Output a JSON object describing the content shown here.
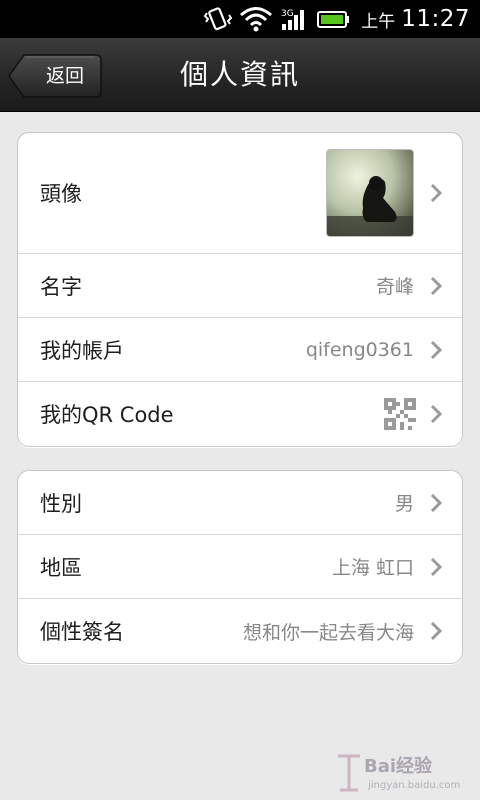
{
  "status_bar": {
    "ampm": "上午",
    "time": "11:27",
    "icons": [
      "vibrate-icon",
      "wifi-icon",
      "signal-icon",
      "battery-icon"
    ]
  },
  "header": {
    "back_label": "返回",
    "title": "個人資訊"
  },
  "group1": [
    {
      "label": "頭像",
      "type": "avatar"
    },
    {
      "label": "名字",
      "value": "奇峰"
    },
    {
      "label": "我的帳戶",
      "value": "qifeng0361"
    },
    {
      "label": "我的QR Code",
      "type": "qr"
    }
  ],
  "group2": [
    {
      "label": "性別",
      "value": "男"
    },
    {
      "label": "地區",
      "value": "上海 虹口"
    },
    {
      "label": "個性簽名",
      "value": "想和你一起去看大海"
    }
  ],
  "watermark": {
    "brand": "Bai经验",
    "url": "jingyan.baidu.com"
  },
  "colors": {
    "background": "#e9e9e9",
    "titlebar": "#262626",
    "value_text": "#888888",
    "chevron": "#9a9a9a"
  }
}
